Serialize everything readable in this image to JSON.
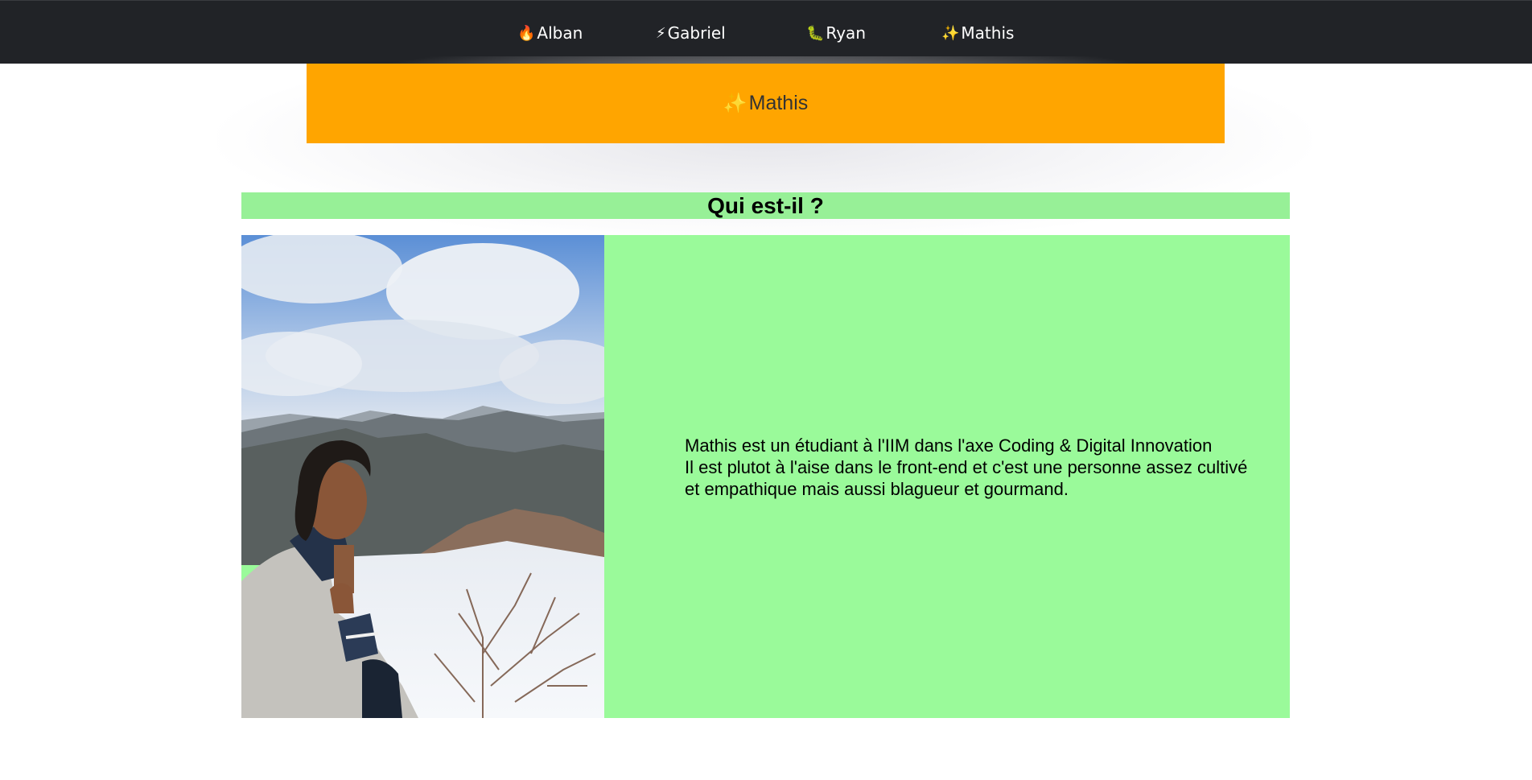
{
  "nav": {
    "items": [
      {
        "icon": "🔥",
        "icon_name": "fire-icon",
        "label": "Alban"
      },
      {
        "icon": "⚡",
        "icon_name": "lightning-icon",
        "label": "Gabriel"
      },
      {
        "icon": "🐛",
        "icon_name": "caterpillar-icon",
        "label": "Ryan"
      },
      {
        "icon": "✨",
        "icon_name": "sparkles-icon",
        "label": "Mathis"
      }
    ]
  },
  "banner": {
    "icon": "✨",
    "icon_name": "sparkles-icon",
    "title": "Mathis"
  },
  "section": {
    "heading": "Qui est-il ?"
  },
  "bio": {
    "line1": "Mathis est un étudiant à l'IIM dans l'axe Coding & Digital Innovation",
    "line2": "Il est plutot à l'aise dans le front-end et c'est une personne assez cultivé et empathique mais aussi blagueur et gourmand."
  },
  "colors": {
    "navbar": "#212327",
    "banner": "#ffa500",
    "heading_bg": "#97f097",
    "content_bg": "#9afa9a"
  }
}
